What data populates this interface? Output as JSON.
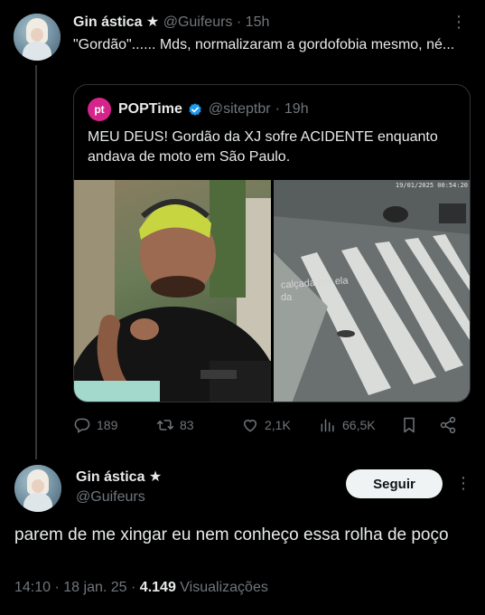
{
  "reply_tweet": {
    "display_name": "Gin ástica ★",
    "handle": "@Guifeurs",
    "time": "15h",
    "text": "\"Gordão\"...... Mds, normalizaram a gordofobia mesmo, né..."
  },
  "quoted_tweet": {
    "display_name": "POPTime",
    "logo_text": "pt",
    "handle": "@siteptbr",
    "time": "19h",
    "text": "MEU DEUS! Gordão da XJ sofre ACIDENTE enquanto andava de moto em São Paulo.",
    "right_image_timestamp": "19/01/2025 00:54:20",
    "right_image_caption_1": "calçada por ela",
    "right_image_caption_2": "da"
  },
  "actions": {
    "replies": "189",
    "retweets": "83",
    "likes": "2,1K",
    "views": "66,5K"
  },
  "main_tweet": {
    "display_name": "Gin ástica ★",
    "handle": "@Guifeurs",
    "follow_label": "Seguir",
    "text": "parem de me xingar eu nem conheço essa rolha de poço",
    "time": "14:10",
    "date": "18 jan. 25",
    "views_count": "4.149",
    "views_label": "Visualizações"
  },
  "colors": {
    "background": "#000000",
    "text": "#e7e9ea",
    "muted": "#71767b",
    "border": "#2f3336",
    "verified": "#1d9bf0",
    "poptime_logo": "#d6248a"
  },
  "icons": {
    "more": "more-dots-icon",
    "verified": "verified-badge-icon",
    "reply": "reply-icon",
    "retweet": "retweet-icon",
    "like": "heart-icon",
    "views": "analytics-icon",
    "bookmark": "bookmark-icon",
    "share": "share-icon"
  }
}
